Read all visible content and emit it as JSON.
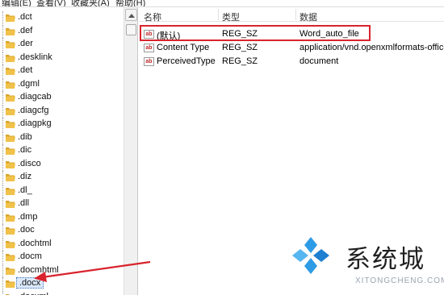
{
  "menubar": {
    "items": [
      "编辑(E)",
      "查看(V)",
      "收藏夹(A)",
      "帮助(H)"
    ]
  },
  "tree": {
    "items": [
      {
        "label": ".dct",
        "selected": false
      },
      {
        "label": ".def",
        "selected": false
      },
      {
        "label": ".der",
        "selected": false
      },
      {
        "label": ".desklink",
        "selected": false
      },
      {
        "label": ".det",
        "selected": false
      },
      {
        "label": ".dgml",
        "selected": false
      },
      {
        "label": ".diagcab",
        "selected": false
      },
      {
        "label": ".diagcfg",
        "selected": false
      },
      {
        "label": ".diagpkg",
        "selected": false
      },
      {
        "label": ".dib",
        "selected": false
      },
      {
        "label": ".dic",
        "selected": false
      },
      {
        "label": ".disco",
        "selected": false
      },
      {
        "label": ".diz",
        "selected": false
      },
      {
        "label": ".dl_",
        "selected": false
      },
      {
        "label": ".dll",
        "selected": false
      },
      {
        "label": ".dmp",
        "selected": false
      },
      {
        "label": ".doc",
        "selected": false
      },
      {
        "label": ".dochtml",
        "selected": false
      },
      {
        "label": ".docm",
        "selected": false
      },
      {
        "label": ".docmhtml",
        "selected": false
      },
      {
        "label": ".docx",
        "selected": true
      },
      {
        "label": ".docxml",
        "selected": false
      }
    ]
  },
  "values": {
    "columns": {
      "name": "名称",
      "type": "类型",
      "data": "数据"
    },
    "rows": [
      {
        "name": "(默认)",
        "type": "REG_SZ",
        "data": "Word_auto_file"
      },
      {
        "name": "Content Type",
        "type": "REG_SZ",
        "data": "application/vnd.openxmlformats-office"
      },
      {
        "name": "PerceivedType",
        "type": "REG_SZ",
        "data": "document"
      }
    ]
  },
  "watermark": {
    "text": "系统城",
    "sub": "XITONGCHENG.COM"
  },
  "colors": {
    "annotation_red": "#d9232d",
    "folder_yellow": "#f1c24a",
    "selection_bg": "#dbe9fb"
  }
}
